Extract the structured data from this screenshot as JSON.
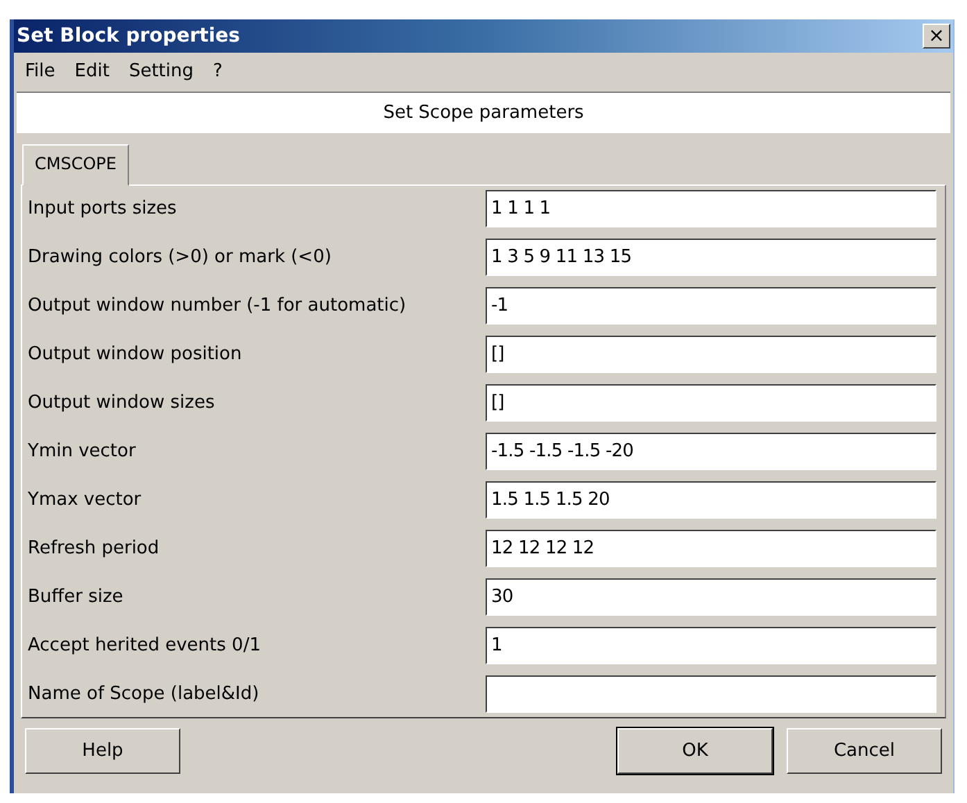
{
  "window": {
    "title": "Set Block properties",
    "close": "×"
  },
  "menu": [
    "File",
    "Edit",
    "Setting",
    "?"
  ],
  "header": "Set Scope parameters",
  "tabs": [
    {
      "label": "CMSCOPE",
      "selected": true
    }
  ],
  "fields": [
    {
      "label": "Input ports sizes",
      "value": "1 1 1 1"
    },
    {
      "label": "Drawing colors (>0) or mark (<0)",
      "value": "1 3 5 9 11 13 15"
    },
    {
      "label": "Output window number (-1 for automatic)",
      "value": "-1"
    },
    {
      "label": "Output window position",
      "value": "[]"
    },
    {
      "label": "Output window sizes",
      "value": "[]"
    },
    {
      "label": "Ymin vector",
      "value": "-1.5 -1.5 -1.5 -20"
    },
    {
      "label": "Ymax vector",
      "value": "1.5 1.5 1.5 20"
    },
    {
      "label": "Refresh period",
      "value": "12 12 12 12"
    },
    {
      "label": "Buffer size",
      "value": "30"
    },
    {
      "label": "Accept herited events 0/1",
      "value": "1"
    },
    {
      "label": "Name of Scope (label&Id)"
    }
  ],
  "buttons": {
    "help": "Help",
    "ok": "OK",
    "cancel": "Cancel"
  }
}
